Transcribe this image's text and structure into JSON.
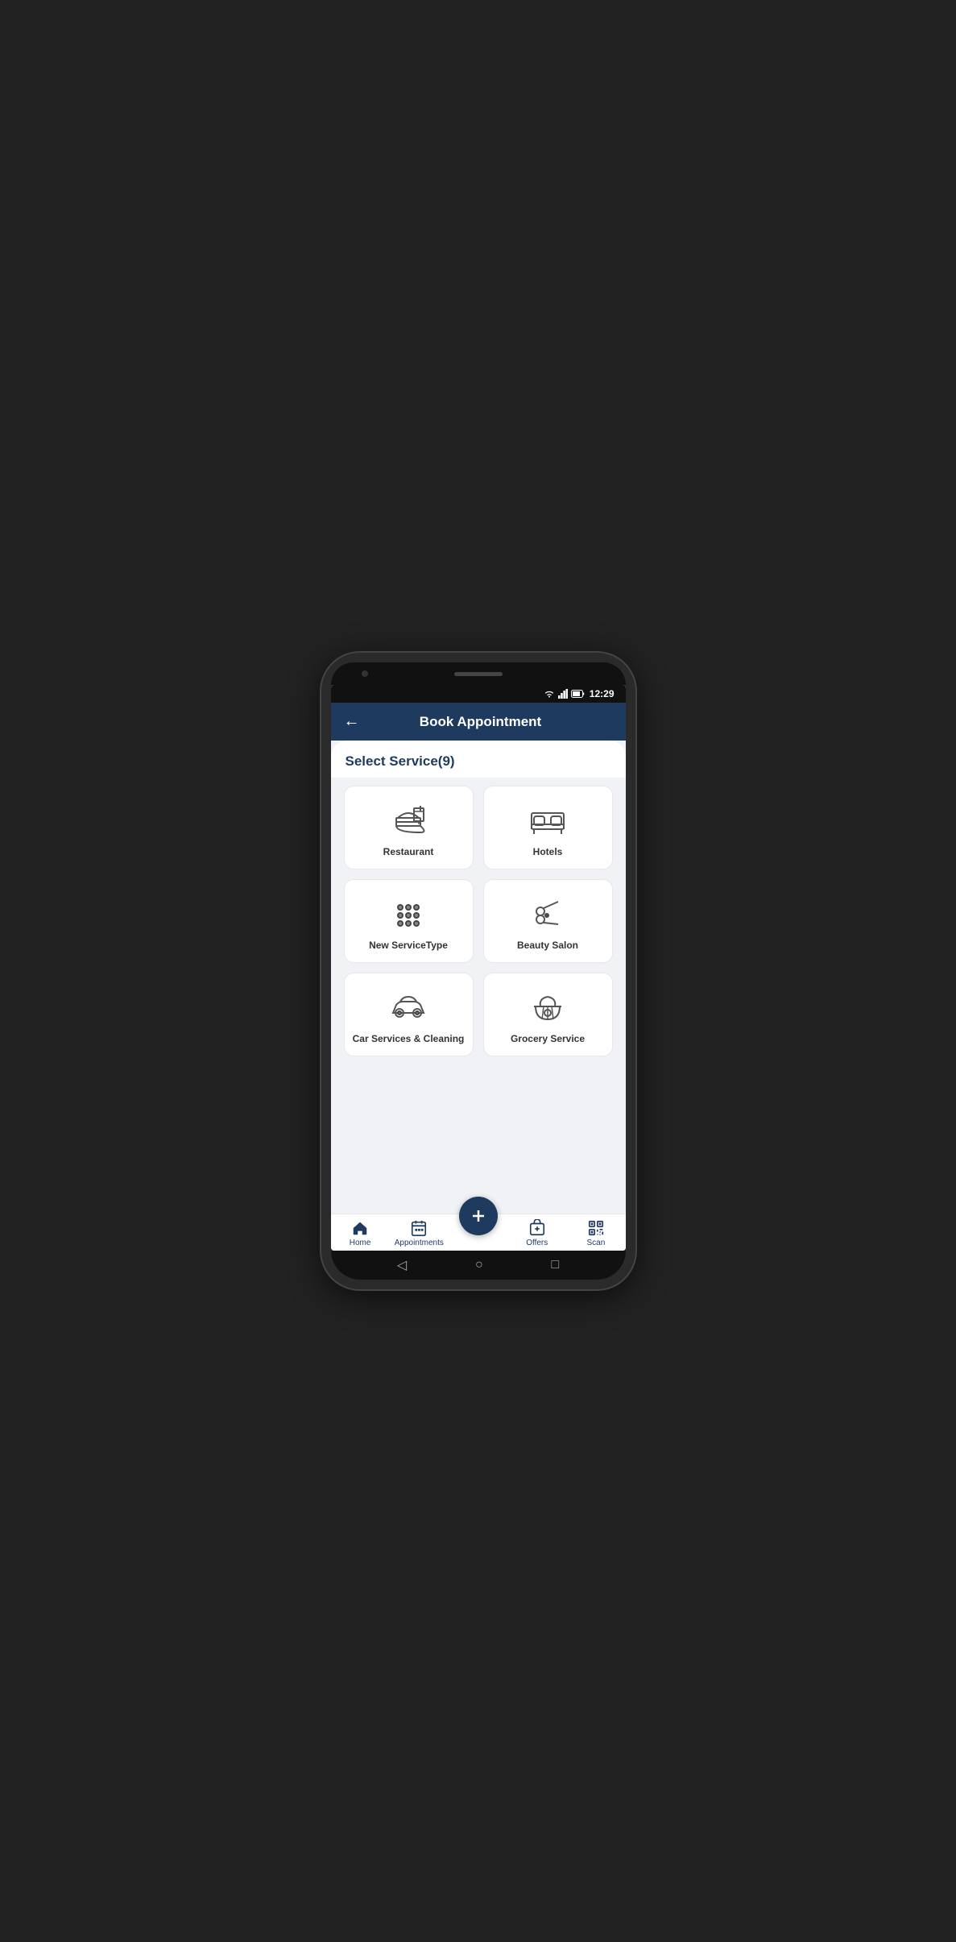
{
  "statusBar": {
    "time": "12:29",
    "icons": [
      "wifi",
      "signal",
      "battery"
    ]
  },
  "header": {
    "title": "Book Appointment",
    "backLabel": "←"
  },
  "main": {
    "sectionTitle": "Select Service(9)",
    "services": [
      {
        "id": "restaurant",
        "label": "Restaurant"
      },
      {
        "id": "hotels",
        "label": "Hotels"
      },
      {
        "id": "new-service-type",
        "label": "New ServiceType"
      },
      {
        "id": "beauty-salon",
        "label": "Beauty Salon"
      },
      {
        "id": "car-services-cleaning",
        "label": "Car Services & Cleaning"
      },
      {
        "id": "grocery-service",
        "label": "Grocery Service"
      }
    ]
  },
  "bottomNav": {
    "items": [
      {
        "id": "home",
        "label": "Home"
      },
      {
        "id": "appointments",
        "label": "Appointments"
      },
      {
        "id": "fab",
        "label": "+"
      },
      {
        "id": "offers",
        "label": "Offers"
      },
      {
        "id": "scan",
        "label": "Scan"
      }
    ]
  }
}
